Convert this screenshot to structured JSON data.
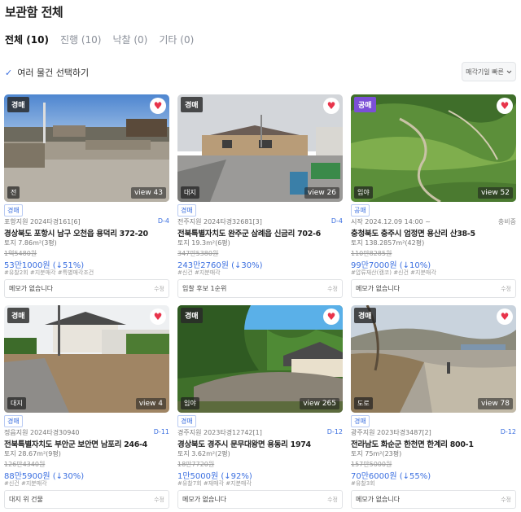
{
  "page": {
    "title": "보관함 전체"
  },
  "tabs": [
    {
      "label": "전체 (10)",
      "active": true
    },
    {
      "label": "진행 (10)",
      "active": false
    },
    {
      "label": "낙찰 (0)",
      "active": false
    },
    {
      "label": "기타 (0)",
      "active": false
    }
  ],
  "toolbar": {
    "multi_select_label": "여러 물건 선택하기",
    "sort_label": "매각기일 빠른",
    "sort_icon": "chevron-down-icon"
  },
  "colors": {
    "accent": "#3b6fe0",
    "heart": "#e8344b",
    "public_badge": "#7b4fd6"
  },
  "cards": [
    {
      "type": "경매",
      "land_badge": "전",
      "views": "view 43",
      "chip": "경매",
      "court": "포항지원 2024타경161[6]",
      "dday": "D-4",
      "address": "경상북도 포항시 남구 오천읍 용덕리 372-20",
      "area": "토지 7.86m²(3평)",
      "original_price": "1억5480원",
      "price": "53만1000원 (↓51%)",
      "tags": "#유찰2회 #지분매각 #특별매각조건",
      "memo": "메모가 없습니다",
      "edit": "수정"
    },
    {
      "type": "경매",
      "land_badge": "대지",
      "views": "view 26",
      "chip": "경매",
      "court": "전주지원 2024타경32681[3]",
      "dday": "D-4",
      "address": "전북특별자치도 완주군 삼례읍 신금리 702-6",
      "area": "토지 19.3m²(6평)",
      "original_price": "347만5380원",
      "price": "243만2760원 (↓30%)",
      "tags": "#신건 #지분매각",
      "memo": "입찰 후보 1순위",
      "edit": "수정"
    },
    {
      "type": "공매",
      "land_badge": "임야",
      "views": "view 52",
      "chip": "공매",
      "court": "시작 2024.12.09 14:00 ~",
      "dday": "충비중",
      "address": "충청북도 충주시 엄정면 용산리 산38-5",
      "area": "토지 138.2857m²(42평)",
      "original_price": "110만8285원",
      "price": "99만7000원 (↓10%)",
      "tags": "#압류재산(캠코) #신건 #지분매각",
      "memo": "메모가 없습니다",
      "edit": "수정"
    },
    {
      "type": "경매",
      "land_badge": "대지",
      "views": "view 4",
      "chip": "경매",
      "court": "정읍지원 2024타경30940",
      "dday": "D-11",
      "address": "전북특별자치도 부안군 보안면 남포리 246-4",
      "area": "토지 28.67m²(9평)",
      "original_price": "126만4340원",
      "price": "88만5900원 (↓30%)",
      "tags": "#신건 #지분매각",
      "memo": "대지 위 건물",
      "edit": "수정"
    },
    {
      "type": "경매",
      "land_badge": "임야",
      "views": "view 265",
      "chip": "경매",
      "court": "경주지원 2023타경12742[1]",
      "dday": "D-12",
      "address": "경상북도 경주시 문무대왕면 용동리 1974",
      "area": "토지 3.62m²(2평)",
      "original_price": "18만7720원",
      "price": "1만5000원 (↓92%)",
      "tags": "#유찰7회 #재매각 #지분매각",
      "memo": "메모가 없습니다",
      "edit": "수정"
    },
    {
      "type": "경매",
      "land_badge": "도로",
      "views": "view 78",
      "chip": "경매",
      "court": "광주지원 2023타경3487[2]",
      "dday": "D-12",
      "address": "전라남도 화순군 한천면 한계리 800-1",
      "area": "토지 75m²(23평)",
      "original_price": "157만5000원",
      "price": "70만6000원 (↓55%)",
      "tags": "#유찰3회",
      "memo": "메모가 없습니다",
      "edit": "수정"
    }
  ]
}
